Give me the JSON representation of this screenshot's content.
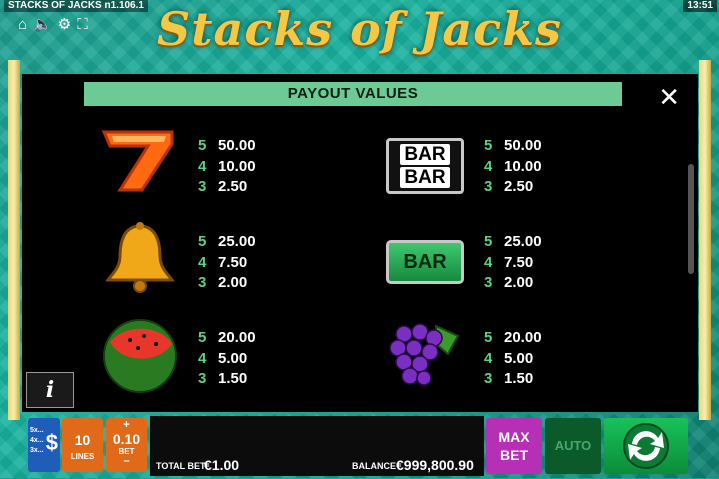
{
  "header": {
    "version": "STACKS OF JACKS n1.106.1",
    "clock": "13:51",
    "logo": "Stacks of Jacks",
    "sys_icons": [
      "home-icon",
      "sound-icon",
      "settings-icon",
      "fullscreen-icon"
    ]
  },
  "paytable": {
    "title": "PAYOUT VALUES",
    "close": "✕",
    "left": [
      {
        "symbol": "seven",
        "rows": [
          {
            "n": "5",
            "v": "50.00"
          },
          {
            "n": "4",
            "v": "10.00"
          },
          {
            "n": "3",
            "v": "2.50"
          }
        ]
      },
      {
        "symbol": "bell",
        "rows": [
          {
            "n": "5",
            "v": "25.00"
          },
          {
            "n": "4",
            "v": "7.50"
          },
          {
            "n": "3",
            "v": "2.00"
          }
        ]
      },
      {
        "symbol": "watermelon",
        "rows": [
          {
            "n": "5",
            "v": "20.00"
          },
          {
            "n": "4",
            "v": "5.00"
          },
          {
            "n": "3",
            "v": "1.50"
          }
        ]
      }
    ],
    "right": [
      {
        "symbol": "double-bar",
        "rows": [
          {
            "n": "5",
            "v": "50.00"
          },
          {
            "n": "4",
            "v": "10.00"
          },
          {
            "n": "3",
            "v": "2.50"
          }
        ]
      },
      {
        "symbol": "single-bar",
        "rows": [
          {
            "n": "5",
            "v": "25.00"
          },
          {
            "n": "4",
            "v": "7.50"
          },
          {
            "n": "3",
            "v": "2.00"
          }
        ]
      },
      {
        "symbol": "grapes",
        "rows": [
          {
            "n": "5",
            "v": "20.00"
          },
          {
            "n": "4",
            "v": "5.00"
          },
          {
            "n": "3",
            "v": "1.50"
          }
        ]
      }
    ],
    "bar_text": "BAR",
    "info": "i"
  },
  "controls": {
    "coin_label": "5x...\n4x...\n3x...",
    "coin_symbol": "$",
    "lines_value": "10",
    "lines_label": "LINES",
    "bet_plus": "+",
    "bet_value": "0.10",
    "bet_label": "BET",
    "bet_minus": "–",
    "total_bet_label": "TOTAL BET",
    "total_bet_value": "€1.00",
    "balance_label": "BALANCE",
    "balance_value": "€999,800.90",
    "maxbet_label": "MAX\nBET",
    "auto_label": "AUTO"
  },
  "colors": {
    "accent_green": "#6ccb94",
    "background_teal": "#18b3a0",
    "button_orange": "#e06a1a",
    "maxbet_purple": "#b530b5",
    "spin_green": "#18c25a"
  }
}
